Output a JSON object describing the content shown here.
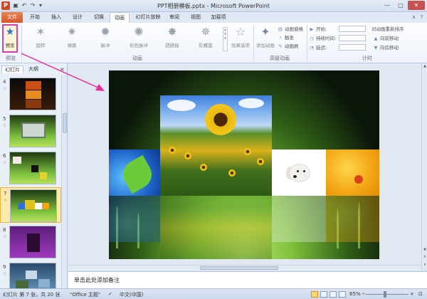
{
  "window": {
    "title": "PPT相册模板.pptx - Microsoft PowerPoint",
    "app_icon": "P",
    "quick_access": [
      "save-icon",
      "undo-icon",
      "redo-icon",
      "customize-icon"
    ],
    "controls": [
      "minimize-icon",
      "maximize-icon",
      "close-icon"
    ]
  },
  "tabs": {
    "file": "文件",
    "items": [
      "开始",
      "插入",
      "设计",
      "切换",
      "动画",
      "幻灯片放映",
      "审阅",
      "视图",
      "加载项"
    ],
    "active": "动画"
  },
  "ribbon": {
    "preview_label": "预览",
    "animations": [
      "旋转",
      "弹跳",
      "脉冲",
      "彩色脉冲",
      "跷跷板",
      "陀螺旋"
    ],
    "effect_options": "效果选项",
    "add_animation": "添加动画",
    "animation_pane": "动画窗格",
    "trigger": "触发",
    "animation_painter": "动画刷",
    "start_label": "开始:",
    "duration_label": "持续时间:",
    "delay_label": "延迟:",
    "reorder_title": "对动画重新排序",
    "move_earlier": "向前移动",
    "move_later": "向后移动",
    "groups": {
      "preview": "预览",
      "animation": "动画",
      "advanced": "高级动画",
      "timing": "计时"
    }
  },
  "panel": {
    "tab_slides": "幻灯片",
    "tab_outline": "大纲",
    "close": "×",
    "thumbnails": [
      {
        "num": "4",
        "star": "☆"
      },
      {
        "num": "5",
        "star": "☆"
      },
      {
        "num": "6",
        "star": "☆"
      },
      {
        "num": "7",
        "star": "☆"
      },
      {
        "num": "8",
        "star": "☆"
      },
      {
        "num": "9",
        "star": "☆"
      }
    ],
    "selected_slide": "7"
  },
  "notes": {
    "placeholder": "单击此处添加备注"
  },
  "status": {
    "slide_info": "幻灯片 第 7 张，共 20 张",
    "theme": "\"Office 主题\"",
    "language": "中文(中国)",
    "zoom": "65%",
    "zoom_minus": "−",
    "zoom_plus": "+"
  },
  "colors": {
    "accent": "#d24726",
    "highlight": "#d63fb0",
    "ribbon_bg": "#fdfdfe",
    "frame": "#d9e4f2"
  }
}
